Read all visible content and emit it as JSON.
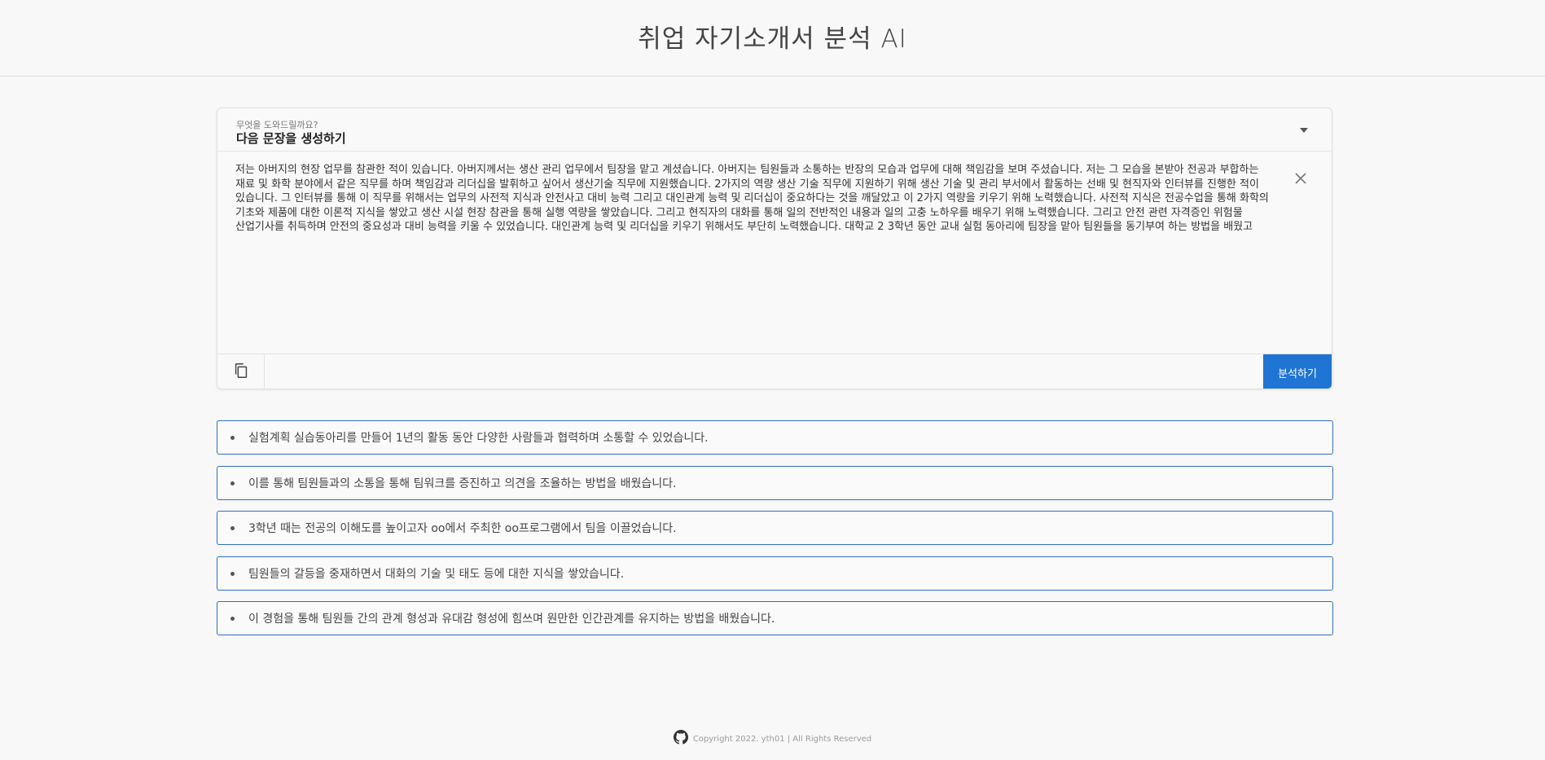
{
  "header": {
    "title": "취업 자기소개서 분석 AI"
  },
  "form": {
    "select_label": "무엇을 도와드릴까요?",
    "select_value": "다음 문장을 생성하기",
    "text": " 저는 아버지의 현장 업무를 참관한 적이 있습니다. 아버지께서는 생산 관리 업무에서 팀장을 맡고 계셨습니다. 아버지는 팀원들과 소통하는 반장의 모습과 업무에 대해 책임감을 보며 주셨습니다. 저는 그 모습을 본받아 전공과 부합하는 재료 및 화학 분야에서 같은 직무를 하며 책임감과 리더십을 발휘하고 싶어서 생산기술 직무에 지원했습니다. 2가지의 역량 생산 기술 직무에 지원하기 위해 생산 기술 및 관리 부서에서 활동하는 선배 및 현직자와 인터뷰를 진행한 적이 있습니다. 그 인터뷰를 통해 이 직무를 위해서는 업무의 사전적 지식과 안전사고 대비 능력 그리고 대인관계 능력 및 리더십이 중요하다는 것을 깨달았고 이 2가지 역량을 키우기 위해 노력했습니다. 사전적 지식은 전공수업을 통해 화학의 기초와 제품에 대한 이론적 지식을 쌓았고 생산 시설 현장 참관을 통해 실행 역량을 쌓았습니다. 그리고 현직자의 대화를 통해 일의 전반적인 내용과 일의 고충 노하우를 배우기 위해 노력했습니다. 그리고 안전 관련 자격증인 위험물 산업기사를 취득하며 안전의 중요성과 대비 능력을 키울 수 있었습니다. 대인관계 능력 및 리더십을 키우기 위해서도 부단히 노력했습니다. 대학교 2 3학년 동안 교내 실험 동아리에 팀장을 맡아 팀원들을 동기부여 하는 방법을 배웠고",
    "analyze_label": "분석하기"
  },
  "results": [
    "실험계획 실습동아리를 만들어 1년의 활동 동안 다양한 사람들과 협력하며 소통할 수 있었습니다.",
    "이를 통해 팀원들과의 소통을 통해 팀워크를 증진하고 의견을 조율하는 방법을 배웠습니다.",
    "3학년 때는 전공의 이해도를 높이고자 oo에서 주최한 oo프로그램에서 팀을 이끌었습니다.",
    "팀원들의 갈등을 중재하면서 대화의 기술 및 태도 등에 대한 지식을 쌓았습니다.",
    "이 경험을 통해 팀원들 간의 관계 형성과 유대감 형성에 힘쓰며 원만한 인간관계를 유지하는 방법을 배웠습니다."
  ],
  "footer": {
    "text": "Copyright 2022. yth01 | All Rights Reserved"
  },
  "colors": {
    "accent": "#1f74d4",
    "result_border": "#2f6fbd"
  },
  "icons": {
    "chevron": "chevron-down-icon",
    "clear": "close-icon",
    "copy": "copy-icon",
    "github": "github-icon"
  }
}
